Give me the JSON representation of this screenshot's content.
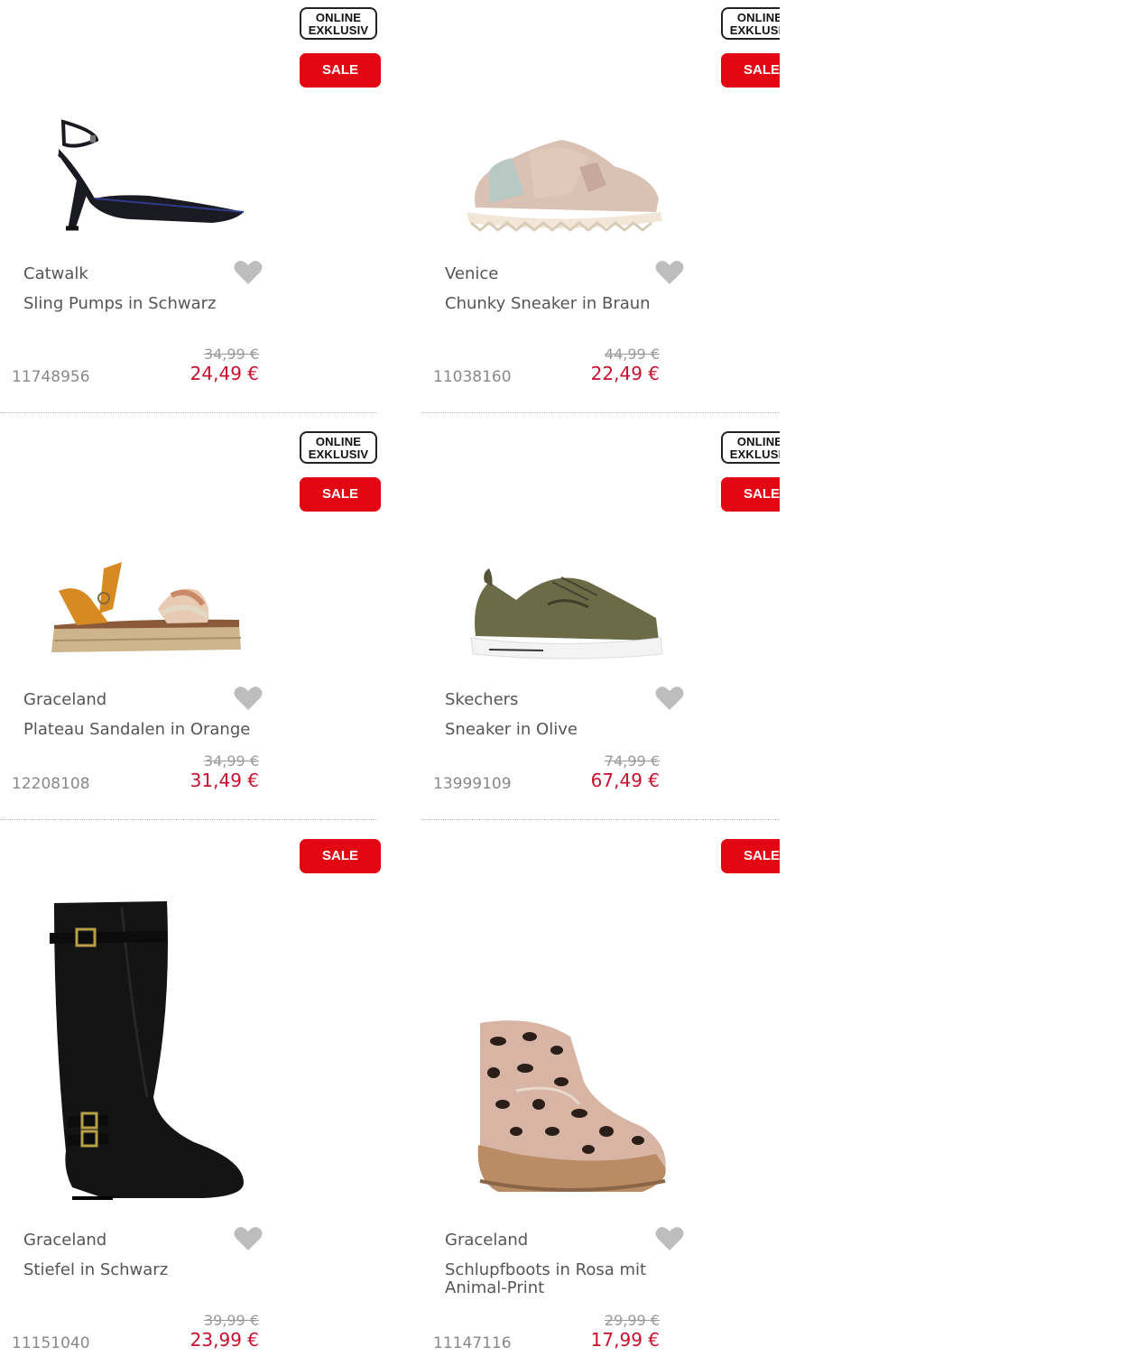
{
  "badges": {
    "online_line1": "ONLINE",
    "online_line2": "EXKLUSIV",
    "sale": "SALE"
  },
  "colors": {
    "sale_red": "#e30613",
    "price_red": "#c8102e",
    "heart_gray": "#bdbdbd"
  },
  "products": [
    {
      "brand": "Catwalk",
      "title": "Sling Pumps in Schwarz",
      "sku": "11748956",
      "old_price": "34,99 €",
      "new_price": "24,49 €",
      "online_exclusive": true,
      "image": "black-slingback-pump"
    },
    {
      "brand": "Venice",
      "title": "Chunky Sneaker in Braun",
      "sku": "11038160",
      "old_price": "44,99 €",
      "new_price": "22,49 €",
      "online_exclusive": true,
      "image": "metallic-chunky-sneaker"
    },
    {
      "brand": "Graceland",
      "title": "Plateau Sandalen in Orange",
      "sku": "12208108",
      "old_price": "34,99 €",
      "new_price": "31,49 €",
      "online_exclusive": true,
      "image": "platform-sandal"
    },
    {
      "brand": "Skechers",
      "title": "Sneaker in Olive",
      "sku": "13999109",
      "old_price": "74,99 €",
      "new_price": "67,49 €",
      "online_exclusive": true,
      "image": "olive-sneaker"
    },
    {
      "brand": "Graceland",
      "title": "Stiefel in Schwarz",
      "sku": "11151040",
      "old_price": "39,99 €",
      "new_price": "23,99 €",
      "online_exclusive": false,
      "image": "black-tall-boot"
    },
    {
      "brand": "Graceland",
      "title": "Schlupfboots in Rosa mit Animal-Print",
      "sku": "11147116",
      "old_price": "29,99 €",
      "new_price": "17,99 €",
      "online_exclusive": false,
      "image": "leopard-snow-boot"
    }
  ]
}
